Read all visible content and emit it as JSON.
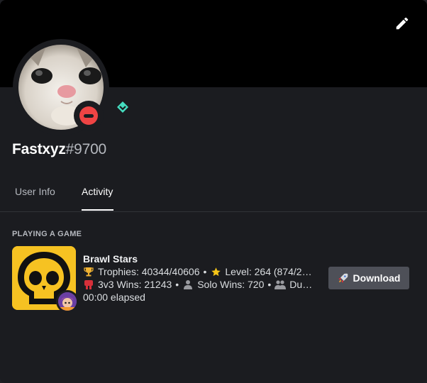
{
  "profile": {
    "username": "Fastxyz",
    "discriminator": "#9700",
    "status": "do-not-disturb",
    "status_color": "#ef4444",
    "badge_icon": "hypesquad-balance-icon",
    "badge_color": "#45ddc0",
    "avatar_icon": "cat-avatar"
  },
  "banner": {
    "color": "#000000",
    "edit_icon": "pencil-icon"
  },
  "tabs": [
    {
      "label": "User Info",
      "active": false
    },
    {
      "label": "Activity",
      "active": true
    }
  ],
  "activity": {
    "heading": "PLAYING A GAME",
    "game_name": "Brawl Stars",
    "details": {
      "trophies": "Trophies: 40344/40606",
      "level": "Level: 264 (874/26…"
    },
    "state": {
      "wins_3v3": "3v3 Wins: 21243",
      "solo_wins": "Solo Wins: 720",
      "duo_wins": "Duo W…"
    },
    "separator": "•",
    "elapsed": "00:00 elapsed",
    "game_icon": "brawl-stars-skull-icon",
    "small_icon": "brawler-portrait-icon",
    "accent_color": "#f6c222"
  },
  "actions": {
    "download_label": "Download",
    "download_icon": "rocket-icon"
  }
}
